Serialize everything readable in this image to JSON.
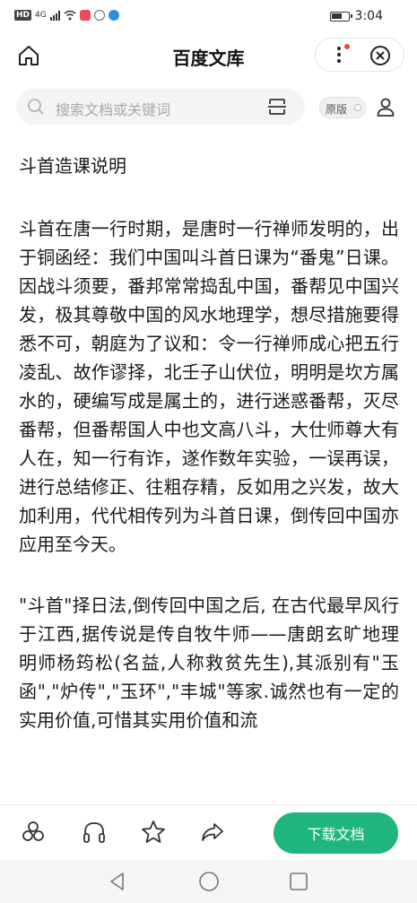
{
  "status_bar": {
    "network_badge": "HD",
    "signal_text": "4G",
    "time": "3:04"
  },
  "header": {
    "title": "百度文库",
    "icons": [
      "home-icon",
      "more-icon",
      "close-icon"
    ]
  },
  "search": {
    "placeholder": "搜索文档或关键词",
    "original_toggle_label": "原版"
  },
  "document": {
    "heading": "斗首造课说明",
    "paragraphs": [
      "斗首在唐一行时期，是唐时一行禅师发明的，出于铜函经：我们中国叫斗首日课为“番鬼”日课。因战斗须要，番邦常常捣乱中国，番帮见中国兴发，极其尊敬中国的风水地理学，想尽措施要得悉不可，朝庭为了议和：令一行禅师成心把五行凌乱、故作谬择，北壬子山伏位，明明是坎方属水的，硬编写成是属土的，进行迷惑番帮，灭尽番帮，但番帮国人中也文高八斗，大仕师尊大有人在，知一行有诈，遂作数年实验，一误再误，进行总结修正、往粗存精，反如用之兴发，故大加利用，代代相传列为斗首日课，倒传回中国亦应用至今天。",
      "\"斗首\"择日法,倒传回中国之后, 在古代最早风行于江西,据传说是传自牧牛师——唐朗玄旷地理明师杨筠松(名益,人称救贫先生),其派别有\"玉函\",\"炉传\",\"玉环\",\"丰城\"等家.诚然也有一定的实用价值,可惜其实用价值和流"
    ]
  },
  "action_bar": {
    "icons": [
      "share-group-icon",
      "headphones-icon",
      "star-icon",
      "forward-icon"
    ],
    "download_label": "下载文档",
    "accent_color": "#1fb57e"
  },
  "nav_bar": {
    "icons": [
      "back-triangle-icon",
      "home-circle-icon",
      "recents-square-icon"
    ]
  }
}
